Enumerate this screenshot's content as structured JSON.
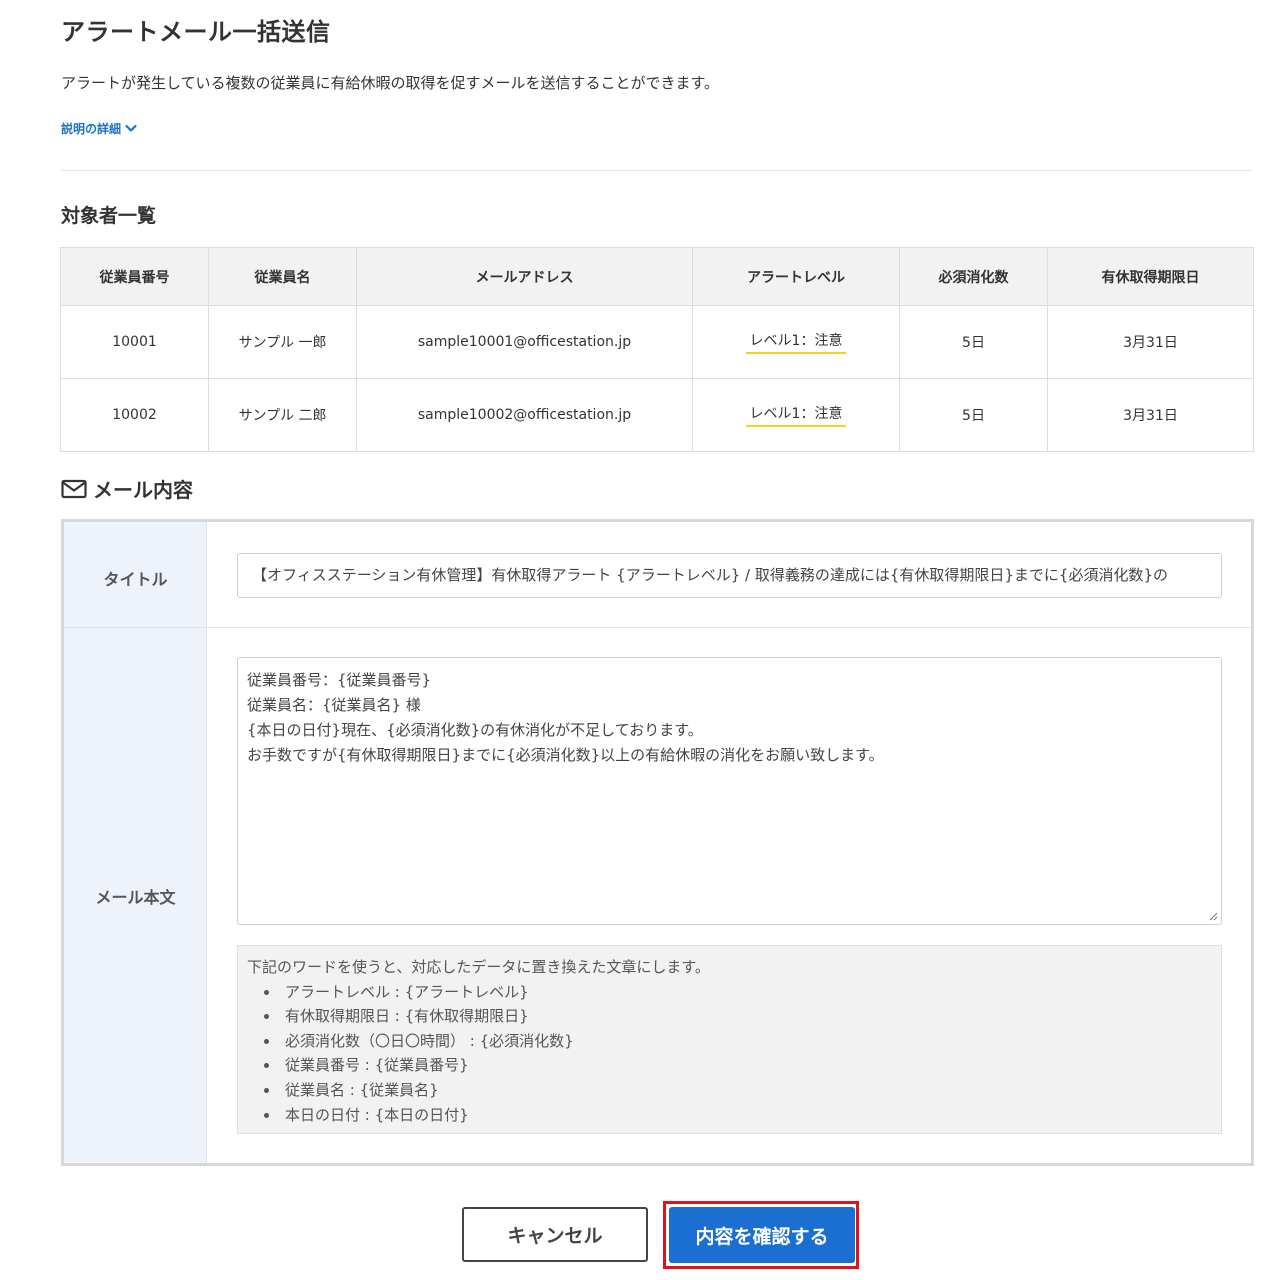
{
  "page": {
    "title": "アラートメール一括送信",
    "description": "アラートが発生している複数の従業員に有給休暇の取得を促すメールを送信することができます。",
    "details_link": "説明の詳細"
  },
  "targets": {
    "section_title": "対象者一覧",
    "columns": [
      "従業員番号",
      "従業員名",
      "メールアドレス",
      "アラートレベル",
      "必須消化数",
      "有休取得期限日"
    ],
    "rows": [
      [
        "10001",
        "サンプル 一郎",
        "sample10001@officestation.jp",
        "レベル1：注意",
        "5日",
        "3月31日"
      ],
      [
        "10002",
        "サンプル 二郎",
        "sample10002@officestation.jp",
        "レベル1：注意",
        "5日",
        "3月31日"
      ]
    ],
    "level_underline_color": "#f2d31b"
  },
  "mail": {
    "section_title": "メール内容",
    "icon": "envelope-icon",
    "title_label": "タイトル",
    "title_value": "【オフィスステーション有休管理】有休取得アラート {アラートレベル} / 取得義務の達成には{有休取得期限日}までに{必須消化数}の",
    "body_label": "メール本文",
    "body_value": "従業員番号：{従業員番号}\n従業員名：{従業員名} 様\n{本日の日付}現在、{必須消化数}の有休消化が不足しております。\nお手数ですが{有休取得期限日}までに{必須消化数}以上の有給休暇の消化をお願い致します。",
    "hint_intro": "下記のワードを使うと、対応したデータに置き換えた文章にします。",
    "hint_items": [
      "アラートレベル : {アラートレベル}",
      "有休取得期限日 : {有休取得期限日}",
      "必須消化数（〇日〇時間） : {必須消化数}",
      "従業員番号 : {従業員番号}",
      "従業員名 : {従業員名}",
      "本日の日付 : {本日の日付}"
    ]
  },
  "actions": {
    "cancel_label": "キャンセル",
    "confirm_label": "内容を確認する",
    "confirm_color": "#1b6fd0",
    "highlight_color": "#e0131b"
  }
}
